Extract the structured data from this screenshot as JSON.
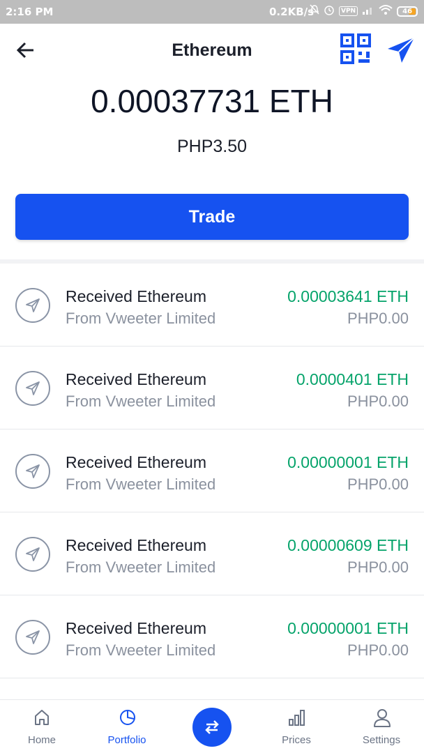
{
  "status_bar": {
    "time": "2:16 PM",
    "network_speed": "0.2KB/s",
    "vpn": "VPN",
    "battery": "46"
  },
  "header": {
    "title": "Ethereum"
  },
  "balance": {
    "crypto": "0.00037731 ETH",
    "fiat": "PHP3.50"
  },
  "actions": {
    "trade_label": "Trade"
  },
  "transactions": [
    {
      "title": "Received Ethereum",
      "subtitle": "From Vweeter Limited",
      "amount": "0.00003641 ETH",
      "fiat": "PHP0.00"
    },
    {
      "title": "Received Ethereum",
      "subtitle": "From Vweeter Limited",
      "amount": "0.0000401 ETH",
      "fiat": "PHP0.00"
    },
    {
      "title": "Received Ethereum",
      "subtitle": "From Vweeter Limited",
      "amount": "0.00000001 ETH",
      "fiat": "PHP0.00"
    },
    {
      "title": "Received Ethereum",
      "subtitle": "From Vweeter Limited",
      "amount": "0.00000609 ETH",
      "fiat": "PHP0.00"
    },
    {
      "title": "Received Ethereum",
      "subtitle": "From Vweeter Limited",
      "amount": "0.00000001 ETH",
      "fiat": "PHP0.00"
    }
  ],
  "bottom_nav": {
    "home": "Home",
    "portfolio": "Portfolio",
    "prices": "Prices",
    "settings": "Settings",
    "active": "portfolio"
  },
  "colors": {
    "accent": "#1652f0",
    "positive": "#05a36a",
    "muted": "#8a919e"
  },
  "icons": {
    "back": "arrow-left-icon",
    "qr": "qr-code-icon",
    "send": "paper-plane-icon",
    "received": "paper-plane-outline-icon",
    "home": "home-icon",
    "portfolio": "pie-chart-icon",
    "transfer": "swap-arrows-icon",
    "prices": "bar-chart-icon",
    "settings": "user-icon"
  }
}
